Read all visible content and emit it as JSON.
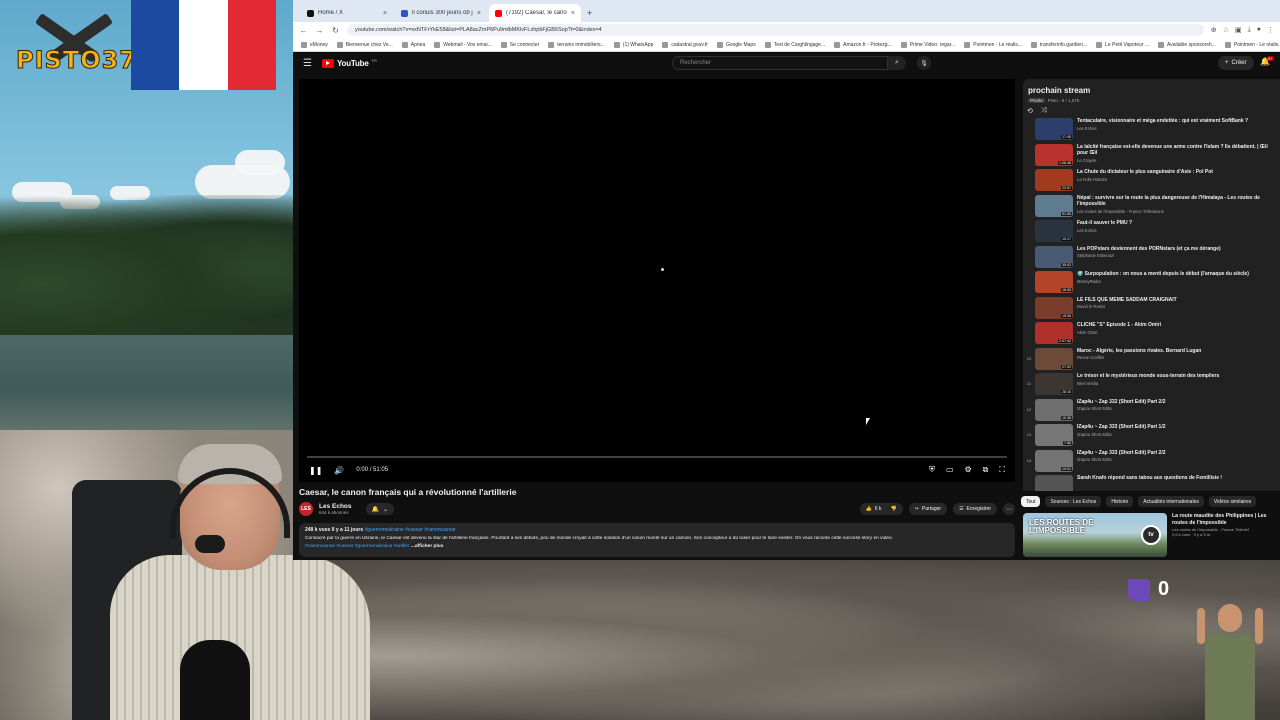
{
  "overlay": {
    "logo_text": "PISTO37",
    "counter": "0",
    "flag_colors": [
      "#1c4aa0",
      "#ffffff",
      "#e22a35"
    ]
  },
  "browser": {
    "tabs": [
      {
        "label": "Home / X",
        "icon": "x-icon",
        "color": "#111111",
        "active": false
      },
      {
        "label": "il conuis 300 jeuns ob jeu sur",
        "icon": "page-icon",
        "color": "#2a56c6",
        "active": false
      },
      {
        "label": "(7192) Caesar, le canon franç",
        "icon": "youtube-icon",
        "color": "#ff0000",
        "active": true
      }
    ],
    "url": "youtube.com/watch?v=xxNTFrYkE58&list=PLA8acZmP6Pu9mlbMKlvFLxhpbFjGB6Sop?t=0&index=4",
    "bookmarks": [
      "eMoney",
      "Bienvenue chez Ve...",
      "Apnea",
      "Webmail - Vos emai...",
      "Se connecter",
      "terrains immobiliers...",
      "(1) WhatsApp",
      "cadastral.gouv.fr",
      "Google Maps",
      "Test de Carghlingage...",
      "Amazon.fr - Protezg...",
      "Prime Video: regar...",
      "Pointmen - Le réalis...",
      "transferinfo.gardien...",
      "Le Petit Vapoteur ...",
      "Available sponsorsh...",
      "Pointmen - Le réalis..."
    ]
  },
  "youtube": {
    "logo_text": "YouTube",
    "country": "FR",
    "search_placeholder": "Rechercher",
    "create_label": "Créer",
    "bell_badge": "9+",
    "player": {
      "time": "0:00 / 51:05",
      "progress": 0
    },
    "video_title": "Caesar, le canon français qui a révolutionné l'artillerie",
    "channel": {
      "name": "Les Echos",
      "subs": "644 k abonnés",
      "avatar_text": "LES"
    },
    "likes": "6 k",
    "share_label": "Partager",
    "save_label": "Enregistrer",
    "description": {
      "meta": "248 k vues  Il y a 11 jours ",
      "meta_tags": "#guerreenukraine #caesar #canoncaesar",
      "text": "Consacré par la guerre en Ukraine, le Caesar est devenu la star de l'artillerie française. Pourtant à ses débuts, peu de monde croyait à cette solution d'un canon monté sur un camion. Son concepteur a dû ruser pour le faire exister. On vous raconte cette success story en vidéo.",
      "tags": "#canoncaesar #caesar #guerreenukraine #artiller",
      "more": "...afficher plus"
    },
    "playlist": {
      "title": "prochain stream",
      "privacy": "Privée",
      "owner": "Pisto - 6 / 1,575",
      "items": [
        {
          "num": "",
          "title": "Tentaculaire, visionnaire et méga endettée : qui est vraiment SoftBank ?",
          "channel": "Les Echos",
          "duration": "17:45",
          "color": "#2c3e6b"
        },
        {
          "num": "",
          "title": "La laïcité française est-elle devenue une arme contre l'Islam ? Ils débattent. | Œil pour Œil",
          "channel": "Le Crayon",
          "duration": "1:06:48",
          "color": "#b8332f"
        },
        {
          "num": "",
          "title": "La Chute du dictateur le plus sanguinaire d'Asie : Pol Pot",
          "channel": "La Folle Histoire",
          "duration": "22:57",
          "color": "#a23a1d"
        },
        {
          "num": "",
          "title": "Népal : survivre sur la route la plus dangereuse de l'Himalaya - Les routes de l'impossible",
          "channel": "Les routes de l'impossible - France Télévisions",
          "duration": "51:55",
          "color": "#5f7b8f"
        },
        {
          "num": "",
          "title": "Faut-il sauver le PMU ?",
          "channel": "Les Echos",
          "duration": "10:17",
          "color": "#2b3340"
        },
        {
          "num": "",
          "title": "Les POPstars deviennent des PORNstars (et ça me dérange)",
          "channel": "Stéphanie Eskenazi",
          "duration": "35:53",
          "color": "#4a5a72"
        },
        {
          "num": "",
          "title": "🌍 Surpopulation : on nous a menti depuis le début (l'arnaque du siècle)",
          "channel": "MoneyRadar",
          "duration": "16:05",
          "color": "#b4432a"
        },
        {
          "num": "",
          "title": "LE FILS QUE MÊME SADDAM CRAIGNAIT",
          "channel": "David le Rosso",
          "duration": "15:06",
          "color": "#7a3d2c"
        },
        {
          "num": "",
          "title": "CLICHÉ \"S\" Épisode 1 - Akim Omiri",
          "channel": "Akim Omiri",
          "duration": "2:07:42",
          "color": "#b0302c"
        },
        {
          "num": "10",
          "title": "Maroc - Algérie, les passions rivales. Bernard Lugan",
          "channel": "Revue Conflits",
          "duration": "27:09",
          "color": "#6b4a3a"
        },
        {
          "num": "11",
          "title": "Le trésor et le mystérieux monde sous-terrain des templiers",
          "channel": "Néel média",
          "duration": "28:15",
          "color": "#3b3631"
        },
        {
          "num": "12",
          "title": "IZap4u ~ Zap 332 (Short Edit) Part 2/2",
          "channel": "IZap4u Short Edits",
          "duration": "10:36",
          "color": "#6e6e6e"
        },
        {
          "num": "13",
          "title": "IZap4u ~ Zap 333 (Short Edit) Part 1/2",
          "channel": "IZap4u Short Edits",
          "duration": "7:56",
          "color": "#777777"
        },
        {
          "num": "14",
          "title": "IZap4u ~ Zap 333 (Short Edit) Part 2/2",
          "channel": "IZap4u Short Edits",
          "duration": "10:01",
          "color": "#737373"
        },
        {
          "num": "",
          "title": "Sarah Knafo répond sans tabou aux questions de Femillisie !",
          "channel": "",
          "duration": "",
          "color": "#555555"
        }
      ]
    },
    "chips": [
      "Tout",
      "Sources : Les Echos",
      "Histoire",
      "Actualités internationales",
      "Vidéos similaires"
    ],
    "recommendation": {
      "thumb_text": "LES ROUTES DE L'IMPOSSIBLE",
      "badge": "tv",
      "title": "La route maudite des Philippines | Les routes de l'impossible",
      "meta": "Les routes de l'impossible - France TélévisÏ\n2,6 k vues · Il y a 3 m."
    }
  }
}
